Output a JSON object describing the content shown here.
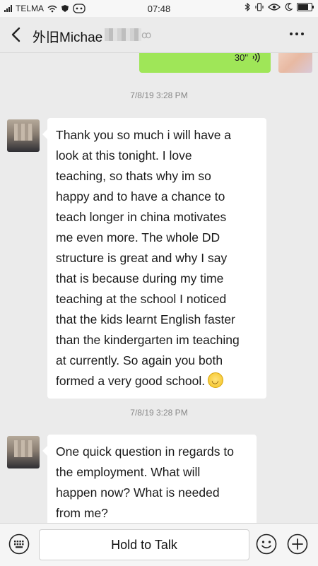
{
  "status_bar": {
    "carrier": "TELMA",
    "time": "07:48"
  },
  "header": {
    "title": "外旧Michae",
    "back_icon": "chevron-left-icon",
    "more_icon": "more-dots-icon"
  },
  "messages": [
    {
      "sender": "self",
      "type": "voice",
      "duration": "30\""
    },
    {
      "timestamp": "7/8/19 3:28 PM"
    },
    {
      "sender": "other",
      "lines": [
        "Thank you so much i will have a",
        "look at this tonight. I love",
        "teaching, so thats why im so",
        "happy and to have a chance to",
        "teach longer in china motivates",
        "me even more. The whole DD",
        "structure is great and why I say",
        "that is because during my time",
        "teaching at the school I noticed",
        "that the kids learnt English faster",
        "than the kindergarten im teaching",
        "at currently. So again you both",
        "formed a very good school."
      ],
      "emoji": "smile-emoji"
    },
    {
      "timestamp": "7/8/19 3:28 PM"
    },
    {
      "sender": "other",
      "lines": [
        "One quick question in regards to",
        "the employment. What will",
        "happen now? What is needed",
        "from me?"
      ]
    }
  ],
  "input_bar": {
    "hold_to_talk": "Hold to Talk",
    "keyboard_icon": "keyboard-icon",
    "emoji_icon": "emoji-icon",
    "plus_icon": "plus-icon"
  },
  "colors": {
    "self_bubble": "#9fe658",
    "background": "#ebebeb",
    "other_bubble": "#ffffff"
  }
}
